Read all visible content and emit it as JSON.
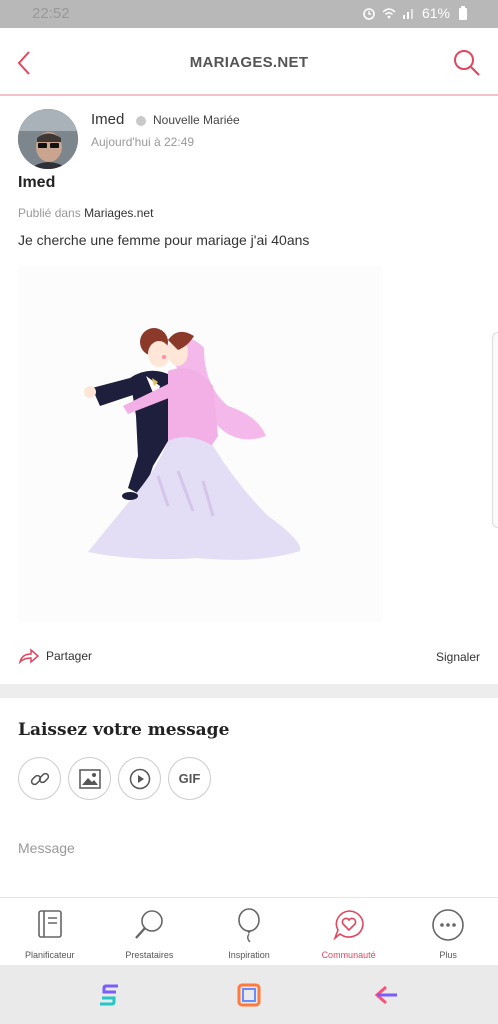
{
  "status_bar": {
    "time": "22:52",
    "battery": "61%",
    "icons": [
      "alarm-icon",
      "wifi-icon",
      "signal-icon",
      "battery-icon"
    ]
  },
  "app_bar": {
    "title": "MARIAGES.NET",
    "back_icon": "chevron-left-icon",
    "search_icon": "search-icon",
    "accent_color": "#e0465e"
  },
  "post": {
    "author": "Imed",
    "author_badge": "Nouvelle Mariée",
    "timestamp": "Aujourd'hui à 22:49",
    "title": "Imed",
    "published_prefix": "Publié dans",
    "published_in": "Mariages.net",
    "body": "Je cherche une femme pour mariage j'ai 40ans",
    "image": "wedding-couple-dancing-illustration",
    "share_label": "Partager",
    "report_label": "Signaler"
  },
  "comment": {
    "title": "Laissez votre message",
    "attach_buttons": [
      {
        "icon": "link-icon"
      },
      {
        "icon": "image-icon"
      },
      {
        "icon": "video-play-icon"
      },
      {
        "icon": "gif-icon",
        "label": "GIF"
      }
    ],
    "message_placeholder": "Message"
  },
  "tab_bar": {
    "items": [
      {
        "label": "Planificateur",
        "icon": "planner-book-icon",
        "active": false
      },
      {
        "label": "Prestataires",
        "icon": "magnifier-icon",
        "active": false
      },
      {
        "label": "Inspiration",
        "icon": "balloon-icon",
        "active": false
      },
      {
        "label": "Communauté",
        "icon": "chat-heart-icon",
        "active": true
      },
      {
        "label": "Plus",
        "icon": "more-dots-icon",
        "active": false
      }
    ]
  },
  "system_nav": {
    "buttons": [
      "recent-apps-icon",
      "home-icon",
      "back-arrow-icon"
    ]
  }
}
